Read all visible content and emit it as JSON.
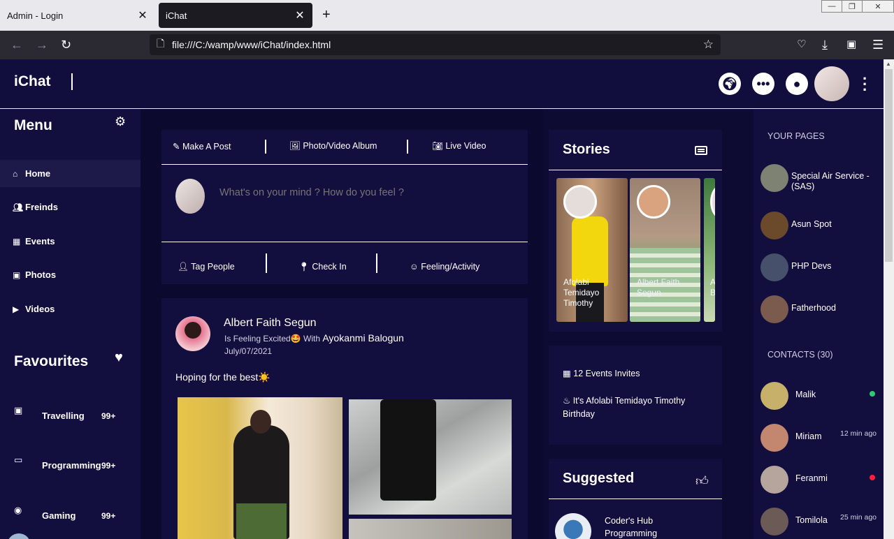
{
  "browser": {
    "tabs": [
      {
        "title": "Admin - Login",
        "active": false
      },
      {
        "title": "iChat",
        "active": true
      }
    ],
    "new_tab": "+",
    "url": "file:///C:/wamp/www/iChat/index.html"
  },
  "header": {
    "brand": "iChat",
    "icons": [
      "globe-icon",
      "chat-bubble-icon",
      "user-circle-icon"
    ]
  },
  "left_menu": {
    "title": "Menu",
    "items": [
      {
        "label": "Home",
        "icon": "home-icon",
        "active": true
      },
      {
        "label": "Freinds",
        "icon": "users-icon",
        "active": false
      },
      {
        "label": "Events",
        "icon": "calendar-icon",
        "active": false
      },
      {
        "label": "Photos",
        "icon": "image-icon",
        "active": false
      },
      {
        "label": "Videos",
        "icon": "play-icon",
        "active": false
      }
    ],
    "favourites_title": "Favourites",
    "favourites": [
      {
        "label": "Travelling",
        "count": "99+",
        "icon": "bus-icon"
      },
      {
        "label": "Programming",
        "count": "99+",
        "icon": "laptop-icon"
      },
      {
        "label": "Gaming",
        "count": "99+",
        "icon": "gamepad-icon"
      }
    ]
  },
  "composer": {
    "options": [
      "Make A Post",
      "Photo/Video Album",
      "Live Video"
    ],
    "placeholder": "What's on your mind ? How do you feel ?",
    "actions": [
      "Tag People",
      "Check In",
      "Feeling/Activity"
    ]
  },
  "post": {
    "author": "Albert Faith Segun",
    "feeling": "Is Feeling Excited🤩 With",
    "with_name": "Ayokanmi Balogun",
    "date": "July/07/2021",
    "text": "Hoping for the best☀️"
  },
  "stories": {
    "title": "Stories",
    "items": [
      {
        "name": "Afolabi Temidayo Timothy"
      },
      {
        "name": "Albert Faith Segun"
      },
      {
        "name": "A B"
      }
    ]
  },
  "events": {
    "invites": "12 Events Invites",
    "birthday": "It's Afolabi Temidayo Timothy Birthday"
  },
  "suggested": {
    "title": "Suggested",
    "items": [
      {
        "name": "Coder's Hub",
        "sub": "Programming"
      }
    ]
  },
  "right_sidebar": {
    "pages_title": "YOUR PAGES",
    "pages": [
      {
        "name": "Special Air Service - (SAS)",
        "color": "#7d8272"
      },
      {
        "name": "Asun Spot",
        "color": "#6b4a2c"
      },
      {
        "name": "PHP Devs",
        "color": "#47506a"
      },
      {
        "name": "Fatherhood",
        "color": "#7a5b4d"
      }
    ],
    "contacts_title": "CONTACTS (30)",
    "contacts": [
      {
        "name": "Malik",
        "status": "online",
        "time": "",
        "dot_color": "#2ecc71",
        "color": "#c7b06a"
      },
      {
        "name": "Miriam",
        "status": "away",
        "time": "12 min ago",
        "dot_color": "",
        "color": "#c2876e"
      },
      {
        "name": "Feranmi",
        "status": "busy",
        "time": "",
        "dot_color": "#ff1f3d",
        "color": "#b5a59c"
      },
      {
        "name": "Tomilola",
        "status": "away",
        "time": "25 min ago",
        "dot_color": "",
        "color": "#6b5a55"
      }
    ]
  }
}
